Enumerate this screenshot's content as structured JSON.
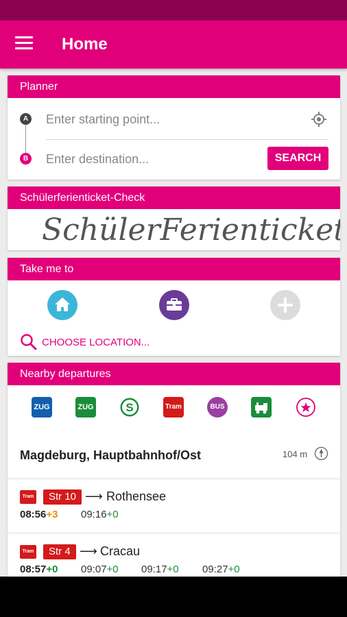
{
  "app_title": "Home",
  "planner": {
    "header": "Planner",
    "marker_a": "A",
    "marker_b": "B",
    "start_placeholder": "Enter starting point...",
    "destination_placeholder": "Enter destination...",
    "search_label": "SEARCH"
  },
  "schueler": {
    "header": "Schülerferienticket-Check",
    "logo_text": "SchülerFerienticket"
  },
  "take_me_to": {
    "header": "Take me to",
    "shortcuts": [
      "home-icon",
      "briefcase-icon",
      "plus-icon"
    ],
    "choose_location": "CHOOSE LOCATION..."
  },
  "nearby": {
    "header": "Nearby departures",
    "modes": [
      {
        "label": "ZUG",
        "color": "#1260ad"
      },
      {
        "label": "ZUG",
        "color": "#1a8d3a"
      },
      {
        "label": "S",
        "color": "#1a8d3a"
      },
      {
        "label": "Tram",
        "color": "#d41a1a"
      },
      {
        "label": "BUS",
        "color": "#9b3fa0"
      },
      {
        "label": "",
        "icon": "train-icon",
        "color": "#1a8d3a"
      },
      {
        "label": "",
        "icon": "star-icon",
        "color": "#e2007a"
      }
    ],
    "station": "Magdeburg, Hauptbahnhof/Ost",
    "distance": "104 m",
    "departures": [
      {
        "mode": "Tram",
        "line": "Str 10",
        "arrow": "⟶",
        "destination": "Rothensee",
        "times": [
          {
            "time": "08:56",
            "delay": "+3"
          },
          {
            "time": "09:16",
            "delay": "+0"
          }
        ]
      },
      {
        "mode": "Tram",
        "line": "Str 4",
        "arrow": "⟶",
        "destination": "Cracau",
        "times": [
          {
            "time": "08:57",
            "delay": "+0"
          },
          {
            "time": "09:07",
            "delay": "+0"
          },
          {
            "time": "09:17",
            "delay": "+0"
          },
          {
            "time": "09:27",
            "delay": "+0"
          }
        ]
      }
    ]
  },
  "colors": {
    "primary": "#e2007a",
    "status_bar": "#8b0050",
    "home": "#3cb6d8",
    "work": "#6a3b97",
    "on_time": "#1a8d3a",
    "late": "#e8900a"
  }
}
